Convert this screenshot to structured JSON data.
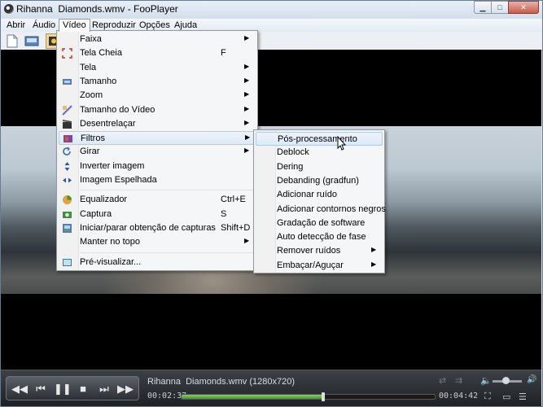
{
  "window": {
    "title": "Rihanna  Diamonds.wmv - FooPlayer",
    "buttons": [
      "minimize",
      "maximize",
      "close"
    ]
  },
  "menubar": {
    "items": [
      {
        "label": "Abrir"
      },
      {
        "label": "Áudio"
      },
      {
        "label": "Vídeo",
        "active": true
      },
      {
        "label": "Reproduzir"
      },
      {
        "label": "Opções"
      },
      {
        "label": "Ajuda"
      }
    ]
  },
  "toolbar": {
    "icons": [
      "file-icon",
      "screenshot-icon",
      "film-icon"
    ]
  },
  "video_menu": {
    "items": [
      {
        "label": "Faixa",
        "icon": "none",
        "shortcut": "",
        "submenu": true
      },
      {
        "label": "Tela Cheia",
        "icon": "fullscreen-icon",
        "shortcut": "F",
        "submenu": false
      },
      {
        "label": "Tela",
        "icon": "none",
        "shortcut": "",
        "submenu": true
      },
      {
        "label": "Tamanho",
        "icon": "resize-icon",
        "shortcut": "",
        "submenu": true
      },
      {
        "label": "Zoom",
        "icon": "none",
        "shortcut": "",
        "submenu": true
      },
      {
        "label": "Tamanho do Vídeo",
        "icon": "aspect-icon",
        "shortcut": "",
        "submenu": true
      },
      {
        "label": "Desentrelaçar",
        "icon": "clapper-icon",
        "shortcut": "",
        "submenu": true
      },
      {
        "label": "Filtros",
        "icon": "filter-icon",
        "shortcut": "",
        "submenu": true,
        "highlighted": true
      },
      {
        "label": "Girar",
        "icon": "rotate-icon",
        "shortcut": "",
        "submenu": true
      },
      {
        "label": "Inverter imagem",
        "icon": "flip-vertical-icon",
        "shortcut": "",
        "submenu": false
      },
      {
        "label": "Imagem Espelhada",
        "icon": "mirror-icon",
        "shortcut": "",
        "submenu": false
      },
      {
        "label": "Equalizador",
        "icon": "equalizer-icon",
        "shortcut": "Ctrl+E",
        "submenu": false
      },
      {
        "label": "Captura",
        "icon": "camera-icon",
        "shortcut": "S",
        "submenu": false
      },
      {
        "label": "Iniciar/parar obtenção de capturas",
        "icon": "capture-multi-icon",
        "shortcut": "Shift+D",
        "submenu": false
      },
      {
        "label": "Manter no topo",
        "icon": "none",
        "shortcut": "",
        "submenu": true
      },
      {
        "label": "Pré-visualizar...",
        "icon": "preview-icon",
        "shortcut": "",
        "submenu": false
      }
    ]
  },
  "filters_submenu": {
    "items": [
      {
        "label": "Pós-processamento",
        "submenu": false,
        "highlighted": true
      },
      {
        "label": "Deblock",
        "submenu": false
      },
      {
        "label": "Dering",
        "submenu": false
      },
      {
        "label": "Debanding (gradfun)",
        "submenu": false
      },
      {
        "label": "Adicionar ruído",
        "submenu": false
      },
      {
        "label": "Adicionar contornos negros",
        "submenu": false
      },
      {
        "label": "Gradação de software",
        "submenu": false
      },
      {
        "label": "Auto detecção de fase",
        "submenu": false
      },
      {
        "label": "Remover ruídos",
        "submenu": true
      },
      {
        "label": "Embaçar/Aguçar",
        "submenu": true
      }
    ]
  },
  "player": {
    "now_playing": "Rihanna  Diamonds.wmv (1280x720)",
    "elapsed": "00:02:37",
    "total": "00:04:42",
    "progress": 0.56,
    "volume": 0.7,
    "buttons": [
      "rewind",
      "previous",
      "pause",
      "stop",
      "next",
      "fast-forward"
    ]
  },
  "colors": {
    "highlight_border": "#aeccec",
    "seek_fill": "#3a9a20",
    "controls_bg": "#1e2125"
  }
}
